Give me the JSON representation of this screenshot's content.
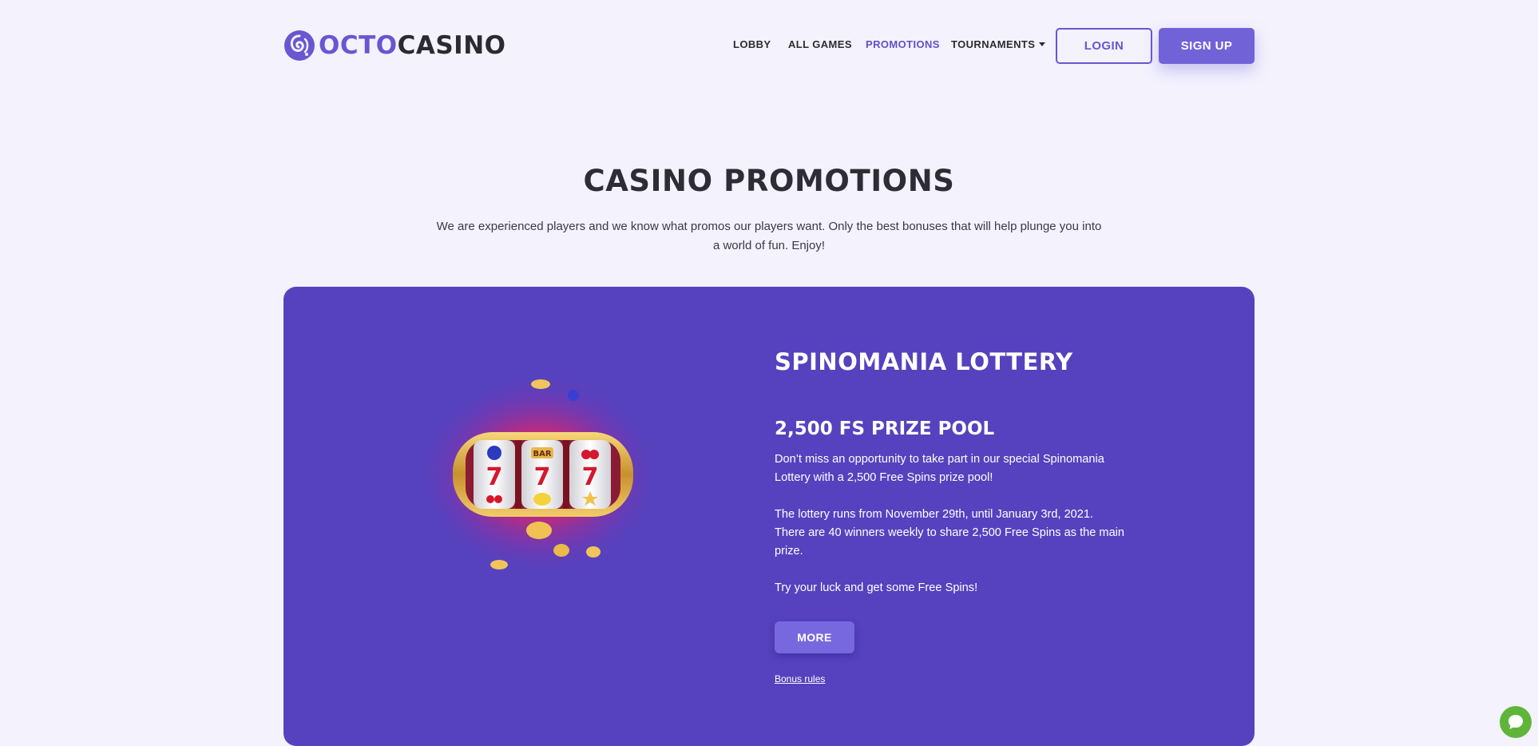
{
  "brand": {
    "logo_part1": "OCTO",
    "logo_part2": "CASINO",
    "brand_color": "#6a55d2"
  },
  "nav": {
    "items": [
      {
        "label": "LOBBY",
        "active": false
      },
      {
        "label": "ALL GAMES",
        "active": false
      },
      {
        "label": "PROMOTIONS",
        "active": true
      },
      {
        "label": "TOURNAMENTS",
        "active": false,
        "has_dropdown": true
      }
    ],
    "login_label": "LOGIN",
    "signup_label": "SIGN UP"
  },
  "page": {
    "title": "CASINO PROMOTIONS",
    "intro_line1": "We are experienced players and we know what promos our players want. Only the best bonuses that will help plunge you into",
    "intro_line2": "a world of fun. Enjoy!"
  },
  "promo": {
    "title": "SPINOMANIA LOTTERY",
    "subtitle": "2,500 FS PRIZE POOL",
    "paragraph1_line1": "Don’t miss an opportunity to take part in our special Spinomania",
    "paragraph1_line2": "Lottery with a 2,500 Free Spins prize pool!",
    "paragraph2_line1": "The lottery runs from November 29th, until January 3rd, 2021.",
    "paragraph2_line2": "There are 40 winners weekly to share 2,500 Free Spins as the main",
    "paragraph2_line3": "prize.",
    "paragraph3": "Try your luck and get some Free Spins!",
    "more_label": "MORE",
    "rules_label": "Bonus rules",
    "card_color": "#5642be",
    "image_icon": "slot-machine-icon",
    "slot_reel_label": "BAR"
  },
  "chat": {
    "icon": "chat-bubble-icon",
    "color": "#5fb53a"
  }
}
